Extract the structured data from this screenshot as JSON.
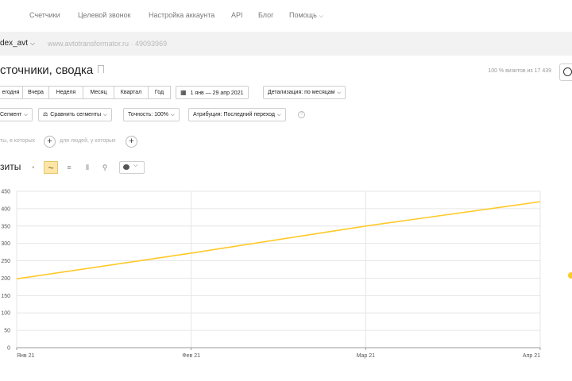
{
  "nav": {
    "items": [
      "Счетчики",
      "Целевой звонок",
      "Настройка аккаунта",
      "API",
      "Блог",
      "Помощь"
    ]
  },
  "counter": {
    "name": "dex_avt",
    "site": "www.avtotransformator.ru · 49093969"
  },
  "report": {
    "title": "сточники, сводка",
    "sample": "100 % визитов из 17 439"
  },
  "periods": {
    "items": [
      "егодня",
      "Вчера",
      "Неделя",
      "Месяц",
      "Квартал",
      "Год"
    ],
    "date_range": "1 янв — 29 апр 2021",
    "detail": "Детализация: по месяцам"
  },
  "filters": {
    "segment": "Сегмент",
    "compare": "Сравнить сегменты",
    "accuracy": "Точность: 100%",
    "attribution": "Атрибуция: Последний переход",
    "people_with": "ты, в которых",
    "people_for": "для людей, у которых"
  },
  "view": {
    "title": "зиты"
  },
  "colors": {
    "line": "#ffc928",
    "grid": "#e6e6e6"
  },
  "chart_data": {
    "type": "line",
    "categories": [
      "Янв 21",
      "Фев 21",
      "Мар 21",
      "Апр 21"
    ],
    "series": [
      {
        "values": [
          198,
          272,
          350,
          420
        ]
      }
    ],
    "yticks": [
      "450",
      "400",
      "350",
      "300",
      "250",
      "200",
      "150",
      "100",
      "50",
      "0"
    ],
    "ylim": [
      0,
      450
    ],
    "grid": true
  }
}
